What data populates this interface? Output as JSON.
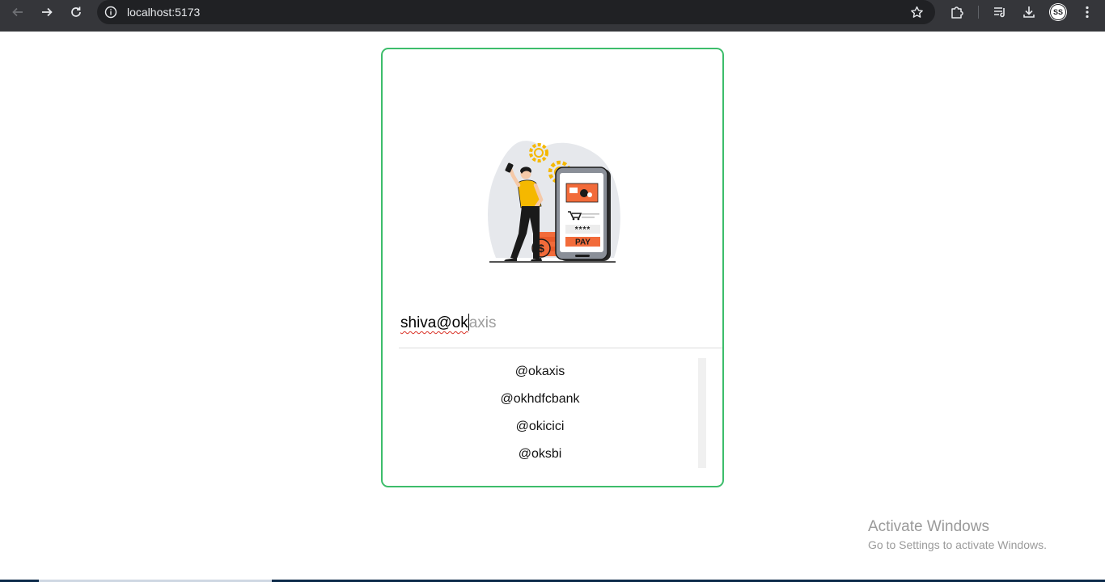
{
  "browser": {
    "url": "localhost:5173",
    "avatar_initials": "SS",
    "icons": {
      "back": "arrow-left-icon",
      "forward": "arrow-right-icon",
      "reload": "reload-icon",
      "site_info": "info-icon",
      "bookmark": "star-icon",
      "extensions": "puzzle-icon",
      "media": "media-queue-icon",
      "downloads": "download-icon",
      "menu": "more-vertical-icon"
    }
  },
  "payment": {
    "illustration": {
      "card_mask": "****",
      "pay_label": "PAY",
      "coin_symbol": "$"
    },
    "upi_input": {
      "typed_value": "shiva@ok",
      "autocomplete_hint": "axis"
    },
    "suggestions": [
      "@okaxis",
      "@okhdfcbank",
      "@okicici",
      "@oksbi"
    ]
  },
  "watermark": {
    "title": "Activate Windows",
    "subtitle": "Go to Settings to activate Windows."
  },
  "colors": {
    "card_border": "#3dbd6b",
    "accent_orange": "#f26b3a",
    "accent_yellow": "#f5b800",
    "chrome_bg": "#35363a"
  }
}
